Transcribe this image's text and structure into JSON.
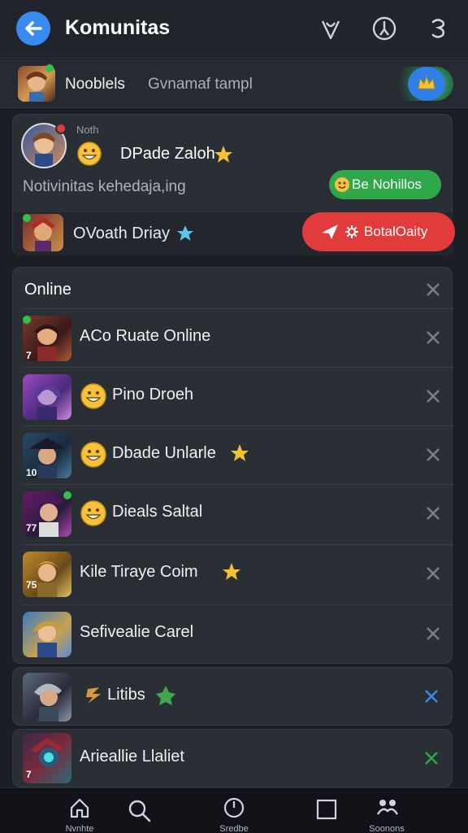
{
  "header": {
    "title": "Komunitas"
  },
  "strip": {
    "name": "Nooblels",
    "subtitle": "Gvnamaf tampl"
  },
  "notification": {
    "small_label": "Noth",
    "name": "DPade Zaloh",
    "description": "Notivinitas kehedaja,ing",
    "green_button": "Be Nohillos",
    "row_name": "OVoath Driay",
    "red_button": "BotalOaity"
  },
  "online": {
    "title": "Online",
    "rows": [
      {
        "name": "ACo Ruate Online",
        "level": "7"
      },
      {
        "name": "Pino Droeh",
        "level": ""
      },
      {
        "name": "Dbade Unlarle",
        "level": "10"
      },
      {
        "name": "Dieals Saltal",
        "level": "77"
      },
      {
        "name": "Kile Tiraye Coim",
        "level": "75"
      },
      {
        "name": "Sefivealie Carel",
        "level": ""
      }
    ]
  },
  "cards": [
    {
      "name": "Litibs"
    },
    {
      "name": "Arieallie Llaliet",
      "level": "7"
    }
  ],
  "nav": {
    "items": [
      {
        "label": "Nvnhte"
      },
      {
        "label": ""
      },
      {
        "label": "Sredbe"
      },
      {
        "label": ""
      },
      {
        "label": "Soonons"
      }
    ]
  },
  "colors": {
    "accent_blue": "#3a8bf0",
    "green": "#2fa84a",
    "red": "#e23b3b",
    "star": "#f2c230"
  }
}
